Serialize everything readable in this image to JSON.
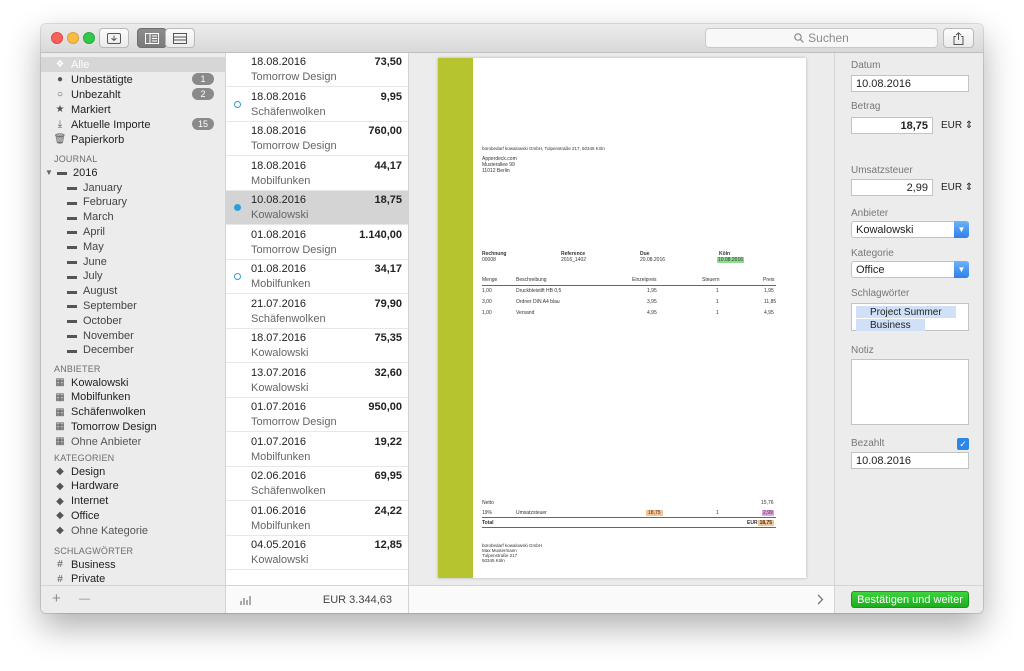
{
  "toolbar": {
    "search_placeholder": "Suchen"
  },
  "sidebar": {
    "top_items": [
      {
        "label": "Alle",
        "badge": ""
      },
      {
        "label": "Unbestätigte",
        "badge": "1"
      },
      {
        "label": "Unbezahlt",
        "badge": "2"
      },
      {
        "label": "Markiert",
        "badge": ""
      },
      {
        "label": "Aktuelle Importe",
        "badge": "15"
      },
      {
        "label": "Papierkorb",
        "badge": ""
      }
    ],
    "journal_heading": "JOURNAL",
    "year": "2016",
    "months": [
      "January",
      "February",
      "March",
      "April",
      "May",
      "June",
      "July",
      "August",
      "September",
      "October",
      "November",
      "December"
    ],
    "vendors_heading": "ANBIETER",
    "vendors": [
      "Kowalowski",
      "Mobilfunken",
      "Schäfenwolken",
      "Tomorrow Design",
      "Ohne Anbieter"
    ],
    "categories_heading": "KATEGORIEN",
    "categories": [
      "Design",
      "Hardware",
      "Internet",
      "Office",
      "Ohne Kategorie"
    ],
    "tags_heading": "SCHLAGWÖRTER",
    "tags": [
      "Business",
      "Private"
    ],
    "add_label": "+",
    "remove_label": "—"
  },
  "list": {
    "items": [
      {
        "date": "18.08.2016",
        "vendor": "Tomorrow Design",
        "amount": "73,50",
        "status": ""
      },
      {
        "date": "18.08.2016",
        "vendor": "Schäfenwolken",
        "amount": "9,95",
        "status": "unpaid"
      },
      {
        "date": "18.08.2016",
        "vendor": "Tomorrow Design",
        "amount": "760,00",
        "status": ""
      },
      {
        "date": "18.08.2016",
        "vendor": "Mobilfunken",
        "amount": "44,17",
        "status": ""
      },
      {
        "date": "10.08.2016",
        "vendor": "Kowalowski",
        "amount": "18,75",
        "status": "unconfirmed"
      },
      {
        "date": "01.08.2016",
        "vendor": "Tomorrow Design",
        "amount": "1.140,00",
        "status": ""
      },
      {
        "date": "01.08.2016",
        "vendor": "Mobilfunken",
        "amount": "34,17",
        "status": "unpaid"
      },
      {
        "date": "21.07.2016",
        "vendor": "Schäfenwolken",
        "amount": "79,90",
        "status": ""
      },
      {
        "date": "18.07.2016",
        "vendor": "Kowalowski",
        "amount": "75,35",
        "status": ""
      },
      {
        "date": "13.07.2016",
        "vendor": "Kowalowski",
        "amount": "32,60",
        "status": ""
      },
      {
        "date": "01.07.2016",
        "vendor": "Tomorrow Design",
        "amount": "950,00",
        "status": ""
      },
      {
        "date": "01.07.2016",
        "vendor": "Mobilfunken",
        "amount": "19,22",
        "status": ""
      },
      {
        "date": "02.06.2016",
        "vendor": "Schäfenwolken",
        "amount": "69,95",
        "status": ""
      },
      {
        "date": "01.06.2016",
        "vendor": "Mobilfunken",
        "amount": "24,22",
        "status": ""
      },
      {
        "date": "04.05.2016",
        "vendor": "Kowalowski",
        "amount": "12,85",
        "status": ""
      }
    ],
    "selected_index": 4,
    "total": "EUR 3.344,63"
  },
  "document": {
    "sender_line": "bürobedarf kowalowski GmbH, Tulpenstraße 217, 50345 Köln",
    "recipient": [
      "Apperdeck.com",
      "Musterallee 99",
      "11012 Berlin"
    ],
    "meta_labels": [
      "Rechnung",
      "Reference",
      "Due",
      "Köln"
    ],
    "meta_values": [
      "00008",
      "2016_1402",
      "20.08.2016",
      "10.08.2016"
    ],
    "table_headers": [
      "Menge",
      "Beschreibung",
      "Einzelpreis",
      "Steuern",
      "Preis"
    ],
    "rows": [
      [
        "1,00",
        "Druckbleistift HB 0,5",
        "1,95",
        "1",
        "1,95"
      ],
      [
        "3,00",
        "Ordner DIN A4 blau",
        "3,95",
        "1",
        "11,85"
      ],
      [
        "1,00",
        "Versand",
        "4,95",
        "1",
        "4,95"
      ]
    ],
    "netto_label": "Netto",
    "netto_value": "15,76",
    "tax_rate": "19%",
    "tax_label": "Umsatzsteuer",
    "tax_base": "18,75",
    "tax_num": "1",
    "tax_value": "2,99",
    "total_label": "Total",
    "total_currency": "EUR",
    "total_value": "18,75",
    "footer": [
      "bürobedarf kowalowski GmbH",
      "Max Mustermann",
      "Tulpenstraße 217",
      "50345 Köln"
    ]
  },
  "inspector": {
    "date_label": "Datum",
    "date_value": "10.08.2016",
    "amount_label": "Betrag",
    "amount_value": "18,75",
    "currency": "EUR",
    "tax_label": "Umsatzsteuer",
    "tax_value": "2,99",
    "vendor_label": "Anbieter",
    "vendor_value": "Kowalowski",
    "category_label": "Kategorie",
    "category_value": "Office",
    "tags_label": "Schlagwörter",
    "tags": [
      "Project Summer",
      "Business"
    ],
    "note_label": "Notiz",
    "paid_label": "Bezahlt",
    "paid_date": "10.08.2016",
    "confirm_label": "Bestätigen und weiter"
  },
  "colors": {
    "accent": "#2e86e8",
    "status_dot": "#2e9fd6",
    "stripe": "#b6c52f",
    "confirm": "#22b822"
  }
}
